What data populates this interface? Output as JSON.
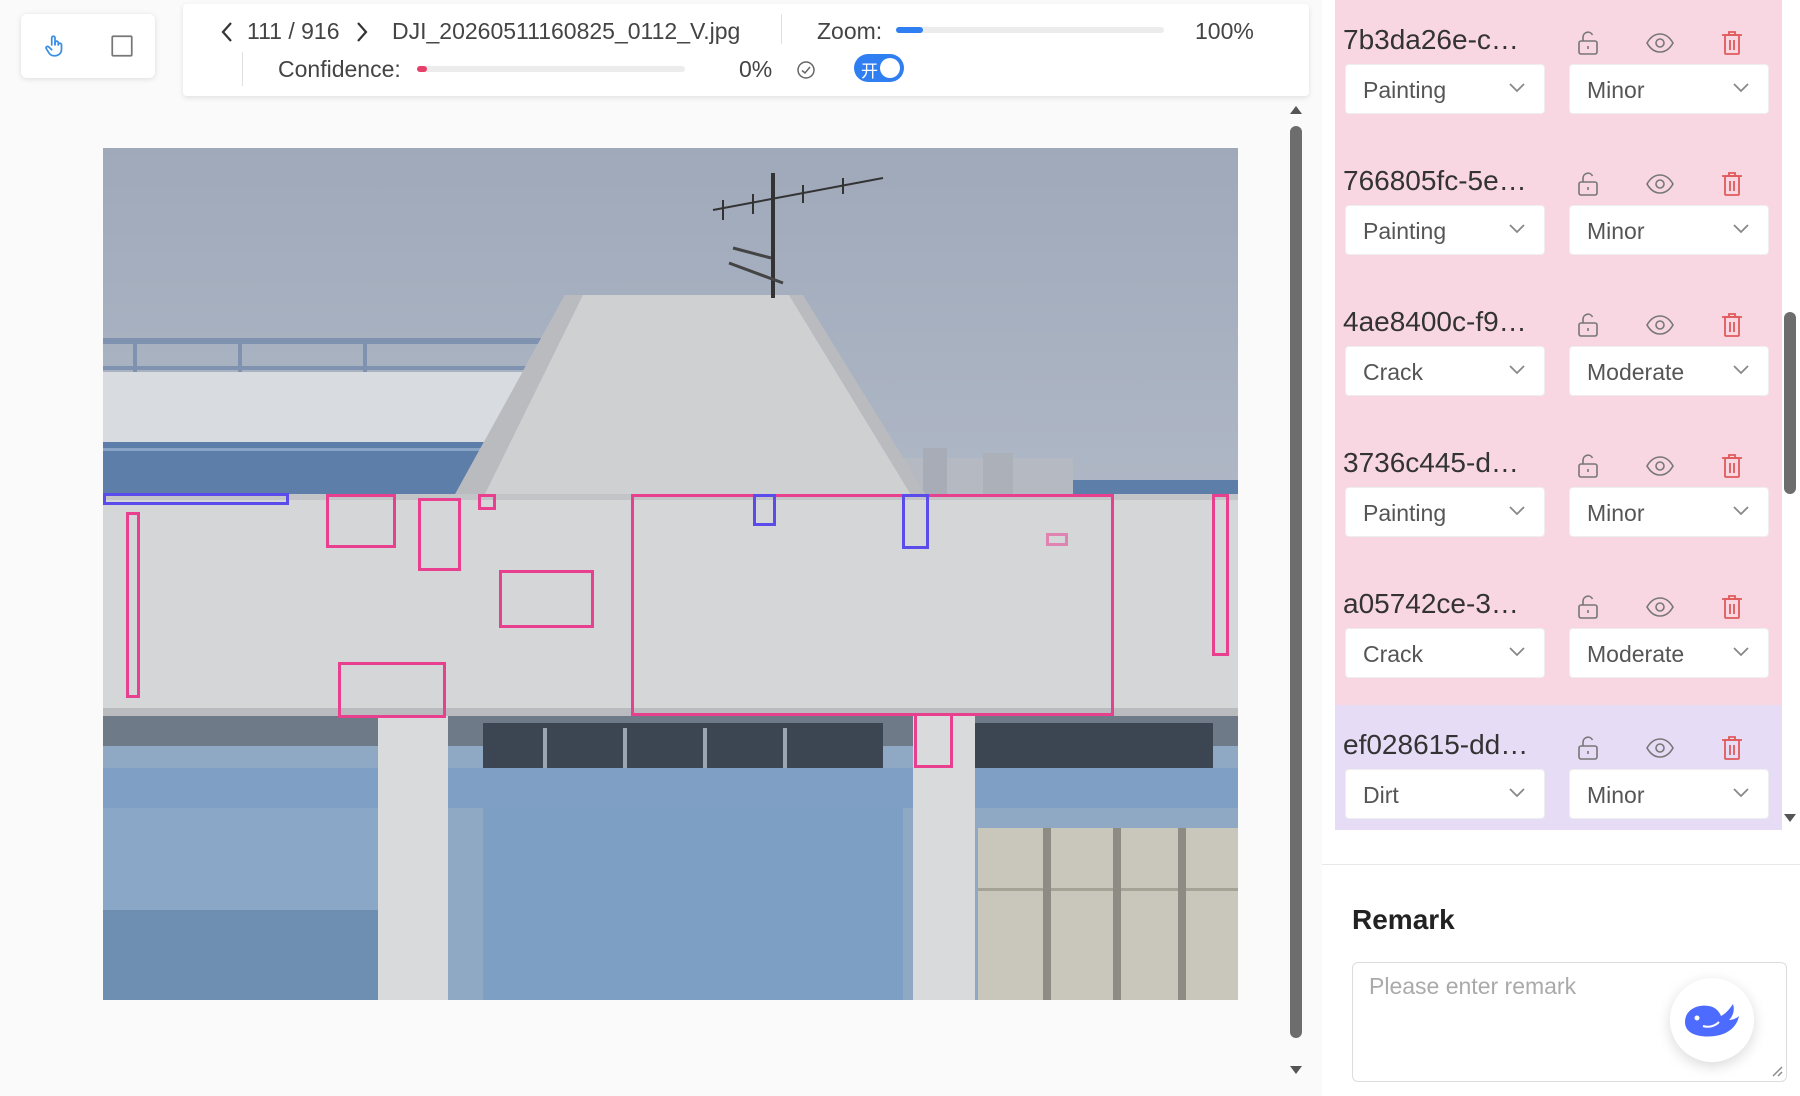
{
  "toolbar": {
    "page_indicator": "111 / 916",
    "filename": "DJI_20260511160825_0112_V.jpg",
    "zoom_label": "Zoom:",
    "zoom_value": "100%",
    "zoom_fraction": 0.1,
    "confidence_label": "Confidence:",
    "confidence_value": "0%",
    "confidence_fraction": 0.0,
    "switch_label": "开",
    "switch_on": true
  },
  "tools": [
    "hand-pointer-icon",
    "rectangle-icon"
  ],
  "annotations": [
    {
      "id": "7b3da26e-c7…",
      "type": "Painting",
      "severity": "Minor",
      "bg": "#f8d7e3"
    },
    {
      "id": "766805fc-5e…",
      "type": "Painting",
      "severity": "Minor",
      "bg": "#f8d7e3"
    },
    {
      "id": "4ae8400c-f9…",
      "type": "Crack",
      "severity": "Moderate",
      "bg": "#f8d7e3"
    },
    {
      "id": "3736c445-d2…",
      "type": "Painting",
      "severity": "Minor",
      "bg": "#f8d7e3"
    },
    {
      "id": "a05742ce-3e…",
      "type": "Crack",
      "severity": "Moderate",
      "bg": "#f8d7e3"
    },
    {
      "id": "ef028615-dd…",
      "type": "Dirt",
      "severity": "Minor",
      "bg": "#e6dcf5"
    }
  ],
  "remark": {
    "title": "Remark",
    "placeholder": "Please enter remark"
  },
  "colors": {
    "accent": "#2f7ff2",
    "box_pink": "#e8408f",
    "box_blue": "#5b4bea",
    "delete_red": "#e05a5a"
  }
}
